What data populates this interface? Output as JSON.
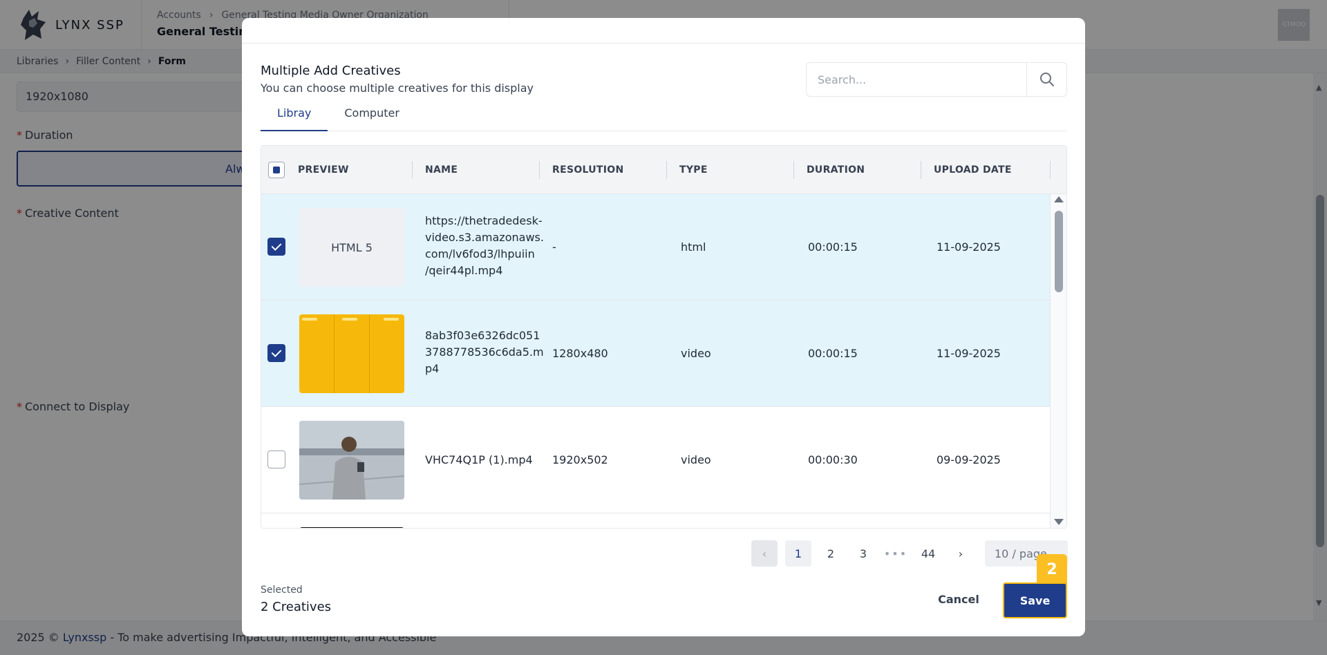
{
  "app": {
    "logo_text": "LYNX SSP",
    "account_crumb": [
      "Accounts",
      "General Testing Media Owner Organization"
    ],
    "account_title": "General Testing",
    "avatar_initials": "GTMOO"
  },
  "breadcrumb": {
    "items": [
      "Libraries",
      "Filler Content",
      "Form"
    ]
  },
  "form": {
    "resolution_value": "1920x1080",
    "duration_label": "Duration",
    "duration_value": "Alw",
    "creative_content_label": "Creative Content",
    "connect_label": "Connect to Display"
  },
  "footer": {
    "copyright": "2025 ©",
    "brand": "Lynxssp",
    "tagline": "- To make advertising Impactful, Intelligent, and Accessible"
  },
  "modal": {
    "title": "Multiple Add Creatives",
    "subtitle": "You can choose multiple creatives for this display",
    "search_placeholder": "Search...",
    "tabs": [
      "Libray",
      "Computer"
    ],
    "active_tab": 0,
    "columns": [
      "PREVIEW",
      "NAME",
      "RESOLUTION",
      "TYPE",
      "DURATION",
      "UPLOAD DATE"
    ],
    "rows": [
      {
        "checked": true,
        "preview": "HTML 5",
        "name": "https://thetradedesk-video.s3.amazonaws.com/lv6fod3/lhpuiin/qeir44pl.mp4",
        "name_lines": [
          "https://thetradedesk-",
          "video.s3.amazonaws.",
          "com/lv6fod3/lhpuiin",
          "/qeir44pl.mp4"
        ],
        "resolution": "-",
        "type": "html",
        "duration": "00:00:15",
        "upload_date": "11-09-2025"
      },
      {
        "checked": true,
        "preview": "yellow-banner-thumbnail",
        "name": "8ab3f03e6326dc0513788778536c6da5.mp4",
        "name_lines": [
          "8ab3f03e6326dc051",
          "3788778536c6da5.m",
          "p4"
        ],
        "resolution": "1280x480",
        "type": "video",
        "duration": "00:00:15",
        "upload_date": "11-09-2025"
      },
      {
        "checked": false,
        "preview": "person-photo-thumbnail",
        "name": "VHC74Q1P (1).mp4",
        "name_lines": [
          "VHC74Q1P (1).mp4"
        ],
        "resolution": "1920x502",
        "type": "video",
        "duration": "00:00:30",
        "upload_date": "09-09-2025"
      }
    ],
    "pagination": {
      "pages": [
        "1",
        "2",
        "3",
        "•••",
        "44"
      ],
      "current": "1",
      "page_size": "10 / page"
    },
    "selected_label": "Selected",
    "selected_count": "2 Creatives",
    "cancel_label": "Cancel",
    "save_label": "Save",
    "step_badge": "2"
  },
  "colors": {
    "primary": "#1f3d8a",
    "selected_row": "#e3f4fb",
    "highlight": "#fbbf24"
  }
}
